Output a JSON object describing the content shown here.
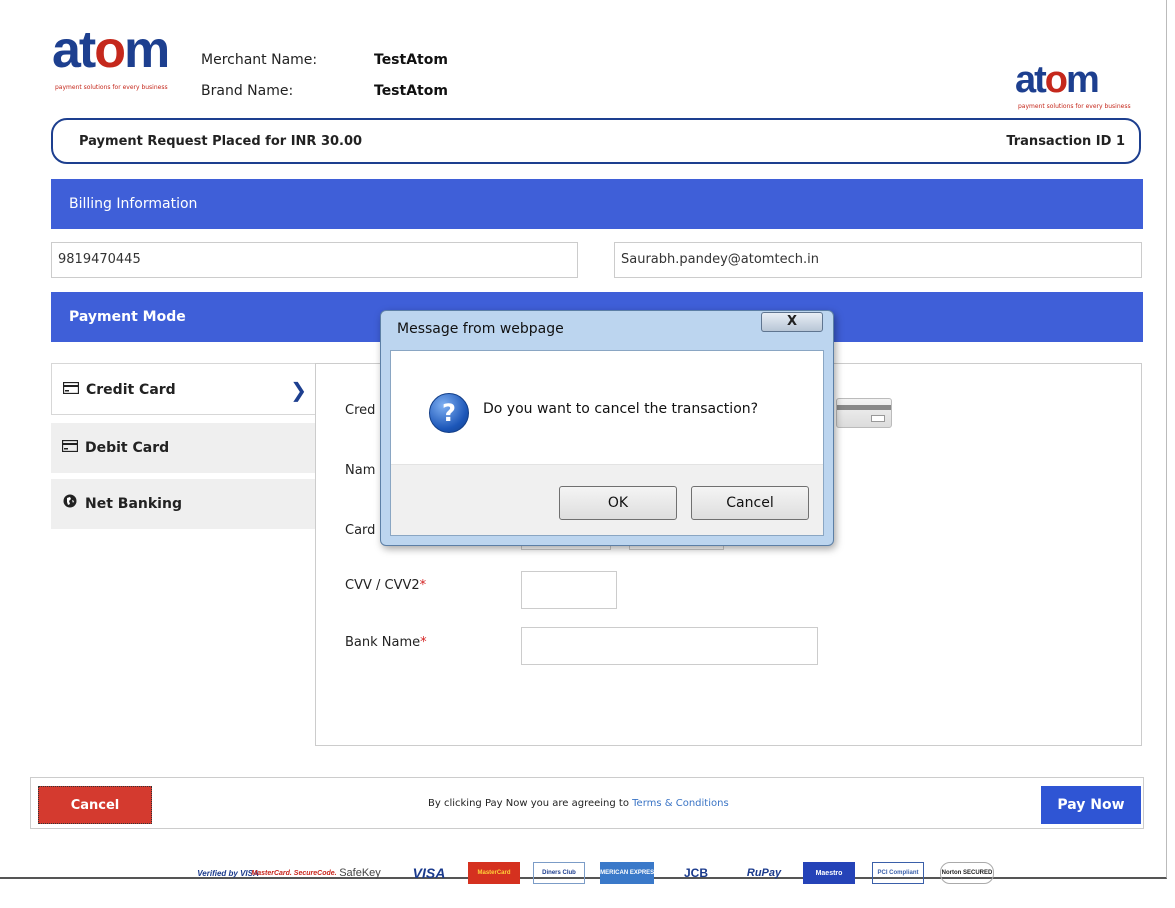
{
  "header": {
    "logo_text": "atom",
    "logo_tagline": "payment solutions for every business",
    "merchant_label": "Merchant Name:",
    "merchant_value": "TestAtom",
    "brand_label": "Brand Name:",
    "brand_value": "TestAtom"
  },
  "summary": {
    "request_text": "Payment Request Placed for INR  30.00",
    "transaction_text": "Transaction ID  1"
  },
  "billing": {
    "title": "Billing Information",
    "phone": "9819470445",
    "email": "Saurabh.pandey@atomtech.in"
  },
  "payment_mode": {
    "title": "Payment Mode",
    "tabs": [
      {
        "label": "Credit Card",
        "icon": "credit-card-icon"
      },
      {
        "label": "Debit Card",
        "icon": "debit-card-icon"
      },
      {
        "label": "Net Banking",
        "icon": "globe-icon"
      }
    ]
  },
  "card_form": {
    "card_number_label_partial": "Cred",
    "name_label_partial": "Nam",
    "card_expiry_label_partial": "Card",
    "cvv_label": "CVV / CVV2",
    "bank_label": "Bank Name",
    "required_mark": "*"
  },
  "footer": {
    "cancel_label": "Cancel",
    "terms_prefix": "By clicking Pay Now you are agreeing to ",
    "terms_link": "Terms & Conditions",
    "pay_label": "Pay Now"
  },
  "badges": [
    {
      "text": "Verified by VISA"
    },
    {
      "text": "MasterCard. SecureCode."
    },
    {
      "text": "SafeKey"
    },
    {
      "text": "VISA"
    },
    {
      "text": "MasterCard"
    },
    {
      "text": "Diners Club"
    },
    {
      "text": "AMERICAN EXPRESS"
    },
    {
      "text": "JCB"
    },
    {
      "text": "RuPay"
    },
    {
      "text": "Maestro"
    },
    {
      "text": "PCI Compliant"
    },
    {
      "text": "Norton SECURED"
    }
  ],
  "dialog": {
    "title": "Message from webpage",
    "close_label": "X",
    "message": "Do you want to cancel the transaction?",
    "icon": "question-icon",
    "ok_label": "OK",
    "cancel_label": "Cancel"
  },
  "colors": {
    "accent": "#3f5fd8",
    "brand": "#1d3f8f",
    "cancel": "#d43a2f",
    "pay": "#2f55d4"
  }
}
